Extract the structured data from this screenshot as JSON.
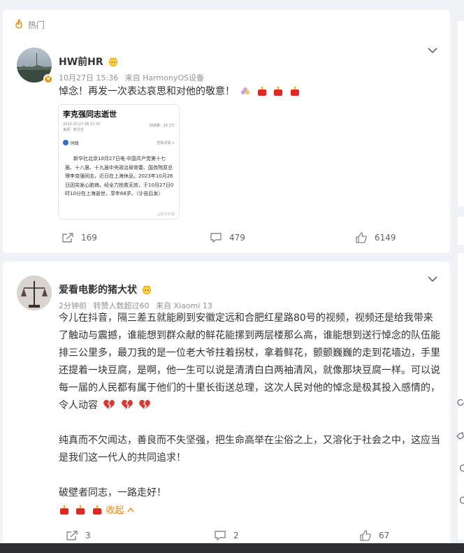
{
  "hot": {
    "label": "热门"
  },
  "post1": {
    "user": {
      "name": "HW前HR"
    },
    "meta": {
      "time": "10月27日 15:36",
      "source": "来自 HarmonyOS设备"
    },
    "text": "悼念！再发一次表达哀思和对他的敬意！",
    "image": {
      "title": "李克强同志逝世",
      "date_line": "2023-10-27 08:17:33",
      "source_line": "来源：新华社",
      "reads": "阅读量：16.2万",
      "account": "时政",
      "more": "查看详情 >",
      "body": "新华社北京10月27日电 中国共产党第十七届、十八届、十九届中央政治局常委、国务院原总理李克强同志，近日在上海休息。2023年10月26日因突发心脏病，经全力抢救无效，于10月27日0时10分在上海逝世，享年68岁。（讣告后发）",
      "watermark": "@经济日报"
    },
    "actions": {
      "reposts": "169",
      "comments": "479",
      "likes": "6149"
    }
  },
  "post2": {
    "user": {
      "name": "爱看电影的猪大状"
    },
    "meta": {
      "time": "2分钟前",
      "likes_info": "转赞人数超过60",
      "source": "来自 Xiaomi 13"
    },
    "paragraphs": [
      "今儿在抖音，隔三差五就能刷到安徽定远和合肥红星路80号的视频，视频还是给我带来了触动与震撼，谁能想到群众献的鲜花能摞到两层楼那么高，谁能想到送行悼念的队伍能排三公里多，最刀我的是一位老大爷拄着拐杖，拿着鲜花，颤颤巍巍的走到花墙边，手里还提着一块豆腐，是啊，他一生可以说是清清白白两袖清风，就像那块豆腐一样。可以说每一届的人民都有属于他们的十里长街送总理，这次人民对他的悼念是极其投入感情的，令人动容",
      "纯真而不欠闻达，善良而不失坚强，把生命高举在尘俗之上，又溶化于社会之中，这应当是我们这一代人的共同追求！",
      "破壁者同志，一路走好！"
    ],
    "collapse_label": "收起",
    "actions": {
      "reposts": "3",
      "comments": "2",
      "likes": "67"
    }
  },
  "colors": {
    "accent": "#ff8200",
    "verified": "#f29100",
    "text": "#333333",
    "meta": "#939393"
  },
  "icons": [
    "fire-icon",
    "crown-icon",
    "chevron-down-icon",
    "candle-icon",
    "broken-heart-icon",
    "repost-icon",
    "comment-icon",
    "like-icon"
  ]
}
